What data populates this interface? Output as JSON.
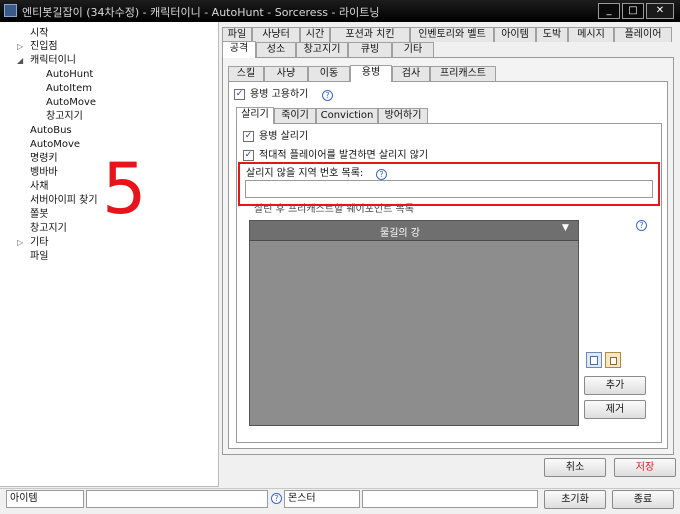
{
  "window": {
    "title": "엔티봇길잡이 (34차수정) - 캐릭터이니 - AutoHunt - Sorceress - 라이트닝",
    "minimize_label": "_",
    "maximize_label": "□",
    "close_label": "✕"
  },
  "tree": {
    "items": [
      {
        "label": "시작",
        "toggle": ""
      },
      {
        "label": "진입점",
        "toggle": "▷"
      },
      {
        "label": "캐릭터이니",
        "toggle": "◢"
      },
      {
        "label": "AutoHunt",
        "toggle": ""
      },
      {
        "label": "AutoItem",
        "toggle": ""
      },
      {
        "label": "AutoMove",
        "toggle": ""
      },
      {
        "label": "창고지기",
        "toggle": ""
      },
      {
        "label": "AutoBus",
        "toggle": ""
      },
      {
        "label": "AutoMove",
        "toggle": ""
      },
      {
        "label": "명령키",
        "toggle": ""
      },
      {
        "label": "벵바바",
        "toggle": ""
      },
      {
        "label": "사채",
        "toggle": ""
      },
      {
        "label": "서버아이피 찾기",
        "toggle": ""
      },
      {
        "label": "쫄봇",
        "toggle": ""
      },
      {
        "label": "창고지기",
        "toggle": ""
      },
      {
        "label": "기타",
        "toggle": "▷"
      },
      {
        "label": "파일",
        "toggle": ""
      }
    ],
    "annotation": "5"
  },
  "top_tabs_row1": [
    "파일",
    "사냥터",
    "시간",
    "포션과 치킨",
    "인벤토리와 벨트",
    "아이템",
    "도박",
    "메시지",
    "플레이어"
  ],
  "top_tabs_row2": [
    "공격",
    "성소",
    "창고지기",
    "큐빙",
    "기타"
  ],
  "sub_tabs": [
    "스킬",
    "사냥",
    "이동",
    "용병",
    "검사",
    "프리캐스트"
  ],
  "merc": {
    "use_label": "용병 고용하기",
    "use_checked": "✓",
    "inner_tabs": [
      "살리기",
      "죽이기",
      "Conviction",
      "방어하기"
    ],
    "revive_label": "용병 살리기",
    "revive_checked": "✓",
    "enemy_label": "적대적 플레이어를 발견하면 살리지 않기",
    "enemy_checked": "✓",
    "no_revive_areas_label": "살리지 않을 지역 번호 목록:",
    "no_revive_areas_value": "",
    "waypoint_label": "살린 후 프리캐스트할 웨이포인트 목록",
    "dropdown_value": "물길의 강",
    "add_label": "추가",
    "remove_label": "제거"
  },
  "footer": {
    "cancel_label": "취소",
    "save_label": "저장",
    "reset_label": "초기화",
    "exit_label": "종료"
  },
  "status": {
    "item_label": "아이템",
    "monster_label": "몬스터"
  },
  "colors": {
    "highlight": "#e01818",
    "save_text": "#e0141c",
    "list_bg": "#8d8d8d",
    "dropdown_bg": "#6f6f6f"
  }
}
